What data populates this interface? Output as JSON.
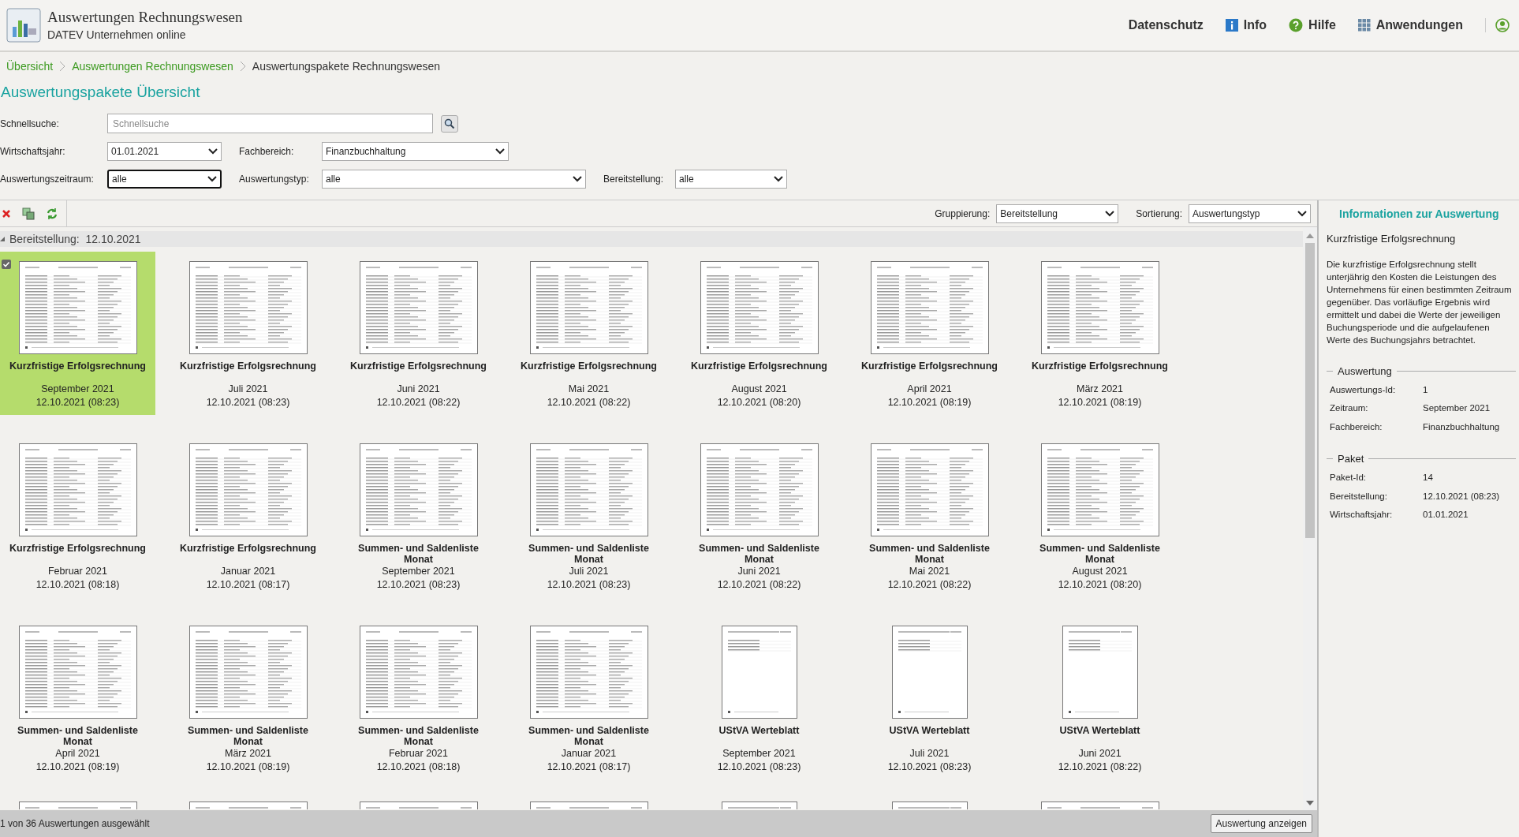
{
  "header": {
    "app_title": "Auswertungen Rechnungswesen",
    "app_subtitle": "DATEV Unternehmen online",
    "nav": [
      {
        "kind": "text",
        "label": "Datenschutz"
      },
      {
        "kind": "info",
        "label": "Info"
      },
      {
        "kind": "help",
        "label": "Hilfe"
      },
      {
        "kind": "apps",
        "label": "Anwendungen"
      },
      {
        "kind": "user"
      }
    ]
  },
  "breadcrumb": [
    {
      "label": "Übersicht",
      "link": true
    },
    {
      "label": "Auswertungen Rechnungswesen",
      "link": true
    },
    {
      "label": "Auswertungspakete Rechnungswesen",
      "link": false
    }
  ],
  "page_title": "Auswertungspakete Übersicht",
  "filters": {
    "quick_search": {
      "label": "Schnellsuche:",
      "placeholder": "Schnellsuche"
    },
    "row1": [
      {
        "label": "Wirtschaftsjahr:",
        "value": "01.01.2021",
        "focused": false
      },
      {
        "label": "Fachbereich:",
        "value": "Finanzbuchhaltung",
        "focused": false
      }
    ],
    "row2": [
      {
        "label": "Auswertungszeitraum:",
        "value": "alle",
        "focused": true
      },
      {
        "label": "Auswertungstyp:",
        "value": "alle",
        "focused": false
      },
      {
        "label": "Bereitstellung:",
        "value": "alle",
        "focused": false
      }
    ]
  },
  "toolbar": {
    "tools": [
      {
        "kind": "delete"
      },
      {
        "kind": "copy"
      },
      {
        "kind": "refresh"
      }
    ],
    "grouping": {
      "label": "Gruppierung:",
      "value": "Bereitstellung"
    },
    "sorting": {
      "label": "Sortierung:",
      "value": "Auswertungstyp"
    }
  },
  "group": {
    "label": "Bereitstellung:",
    "value": "12.10.2021",
    "expanded": true
  },
  "tiles": [
    {
      "title_lines": [
        "Kurzfristige Erfolgsrechnung"
      ],
      "period": "September 2021",
      "date": "12.10.2021 (08:23)",
      "kind": "wide",
      "selected": true
    },
    {
      "title_lines": [
        "Kurzfristige Erfolgsrechnung"
      ],
      "period": "Juli 2021",
      "date": "12.10.2021 (08:23)",
      "kind": "wide",
      "selected": false
    },
    {
      "title_lines": [
        "Kurzfristige Erfolgsrechnung"
      ],
      "period": "Juni 2021",
      "date": "12.10.2021 (08:22)",
      "kind": "wide",
      "selected": false
    },
    {
      "title_lines": [
        "Kurzfristige Erfolgsrechnung"
      ],
      "period": "Mai 2021",
      "date": "12.10.2021 (08:22)",
      "kind": "wide",
      "selected": false
    },
    {
      "title_lines": [
        "Kurzfristige Erfolgsrechnung"
      ],
      "period": "August 2021",
      "date": "12.10.2021 (08:20)",
      "kind": "wide",
      "selected": false
    },
    {
      "title_lines": [
        "Kurzfristige Erfolgsrechnung"
      ],
      "period": "April 2021",
      "date": "12.10.2021 (08:19)",
      "kind": "wide",
      "selected": false
    },
    {
      "title_lines": [
        "Kurzfristige Erfolgsrechnung"
      ],
      "period": "März 2021",
      "date": "12.10.2021 (08:19)",
      "kind": "wide",
      "selected": false
    },
    {
      "title_lines": [
        "Kurzfristige Erfolgsrechnung"
      ],
      "period": "Februar 2021",
      "date": "12.10.2021 (08:18)",
      "kind": "wide",
      "selected": false
    },
    {
      "title_lines": [
        "Kurzfristige Erfolgsrechnung"
      ],
      "period": "Januar 2021",
      "date": "12.10.2021 (08:17)",
      "kind": "wide",
      "selected": false
    },
    {
      "title_lines": [
        "Summen- und Saldenliste",
        "Monat"
      ],
      "period": "September 2021",
      "date": "12.10.2021 (08:23)",
      "kind": "wide",
      "selected": false
    },
    {
      "title_lines": [
        "Summen- und Saldenliste",
        "Monat"
      ],
      "period": "Juli 2021",
      "date": "12.10.2021 (08:23)",
      "kind": "wide",
      "selected": false
    },
    {
      "title_lines": [
        "Summen- und Saldenliste",
        "Monat"
      ],
      "period": "Juni 2021",
      "date": "12.10.2021 (08:22)",
      "kind": "wide",
      "selected": false
    },
    {
      "title_lines": [
        "Summen- und Saldenliste",
        "Monat"
      ],
      "period": "Mai 2021",
      "date": "12.10.2021 (08:22)",
      "kind": "wide",
      "selected": false
    },
    {
      "title_lines": [
        "Summen- und Saldenliste",
        "Monat"
      ],
      "period": "August 2021",
      "date": "12.10.2021 (08:20)",
      "kind": "wide",
      "selected": false
    },
    {
      "title_lines": [
        "Summen- und Saldenliste",
        "Monat"
      ],
      "period": "April 2021",
      "date": "12.10.2021 (08:19)",
      "kind": "wide",
      "selected": false
    },
    {
      "title_lines": [
        "Summen- und Saldenliste",
        "Monat"
      ],
      "period": "März 2021",
      "date": "12.10.2021 (08:19)",
      "kind": "wide",
      "selected": false
    },
    {
      "title_lines": [
        "Summen- und Saldenliste",
        "Monat"
      ],
      "period": "Februar 2021",
      "date": "12.10.2021 (08:18)",
      "kind": "wide",
      "selected": false
    },
    {
      "title_lines": [
        "Summen- und Saldenliste",
        "Monat"
      ],
      "period": "Januar 2021",
      "date": "12.10.2021 (08:17)",
      "kind": "wide",
      "selected": false
    },
    {
      "title_lines": [
        "UStVA Werteblatt"
      ],
      "period": "September 2021",
      "date": "12.10.2021 (08:23)",
      "kind": "narrow",
      "selected": false
    },
    {
      "title_lines": [
        "UStVA Werteblatt"
      ],
      "period": "Juli 2021",
      "date": "12.10.2021 (08:23)",
      "kind": "narrow",
      "selected": false
    },
    {
      "title_lines": [
        "UStVA Werteblatt"
      ],
      "period": "Juni 2021",
      "date": "12.10.2021 (08:22)",
      "kind": "narrow",
      "selected": false
    }
  ],
  "peek_tiles": [
    {
      "kind": "wide"
    },
    {
      "kind": "wide"
    },
    {
      "kind": "wide"
    },
    {
      "kind": "wide"
    },
    {
      "kind": "narrow"
    },
    {
      "kind": "narrow"
    },
    {
      "kind": "wide"
    }
  ],
  "status": {
    "text": "1 von 36 Auswertungen ausgewählt",
    "button": "Auswertung anzeigen"
  },
  "info_panel": {
    "title": "Informationen zur Auswertung",
    "name": "Kurzfristige Erfolgsrechnung",
    "description": "Die kurzfristige Erfolgsrechnung stellt unterjährig den Kosten die Leistungen des Unternehmens für einen bestimmten Zeitraum gegenüber. Das vorläufige Ergebnis wird ermittelt und dabei die Werte der jeweiligen Buchungsperiode und die aufgelaufenen Werte des Buchungsjahrs betrachtet.",
    "sections": [
      {
        "title": "Auswertung",
        "fields": [
          {
            "label": "Auswertungs-Id:",
            "value": "1"
          },
          {
            "label": "Zeitraum:",
            "value": "September 2021"
          },
          {
            "label": "Fachbereich:",
            "value": "Finanzbuchhaltung"
          }
        ]
      },
      {
        "title": "Paket",
        "fields": [
          {
            "label": "Paket-Id:",
            "value": "14"
          },
          {
            "label": "Bereitstellung:",
            "value": "12.10.2021 (08:23)"
          },
          {
            "label": "Wirtschaftsjahr:",
            "value": "01.01.2021"
          }
        ]
      }
    ]
  }
}
